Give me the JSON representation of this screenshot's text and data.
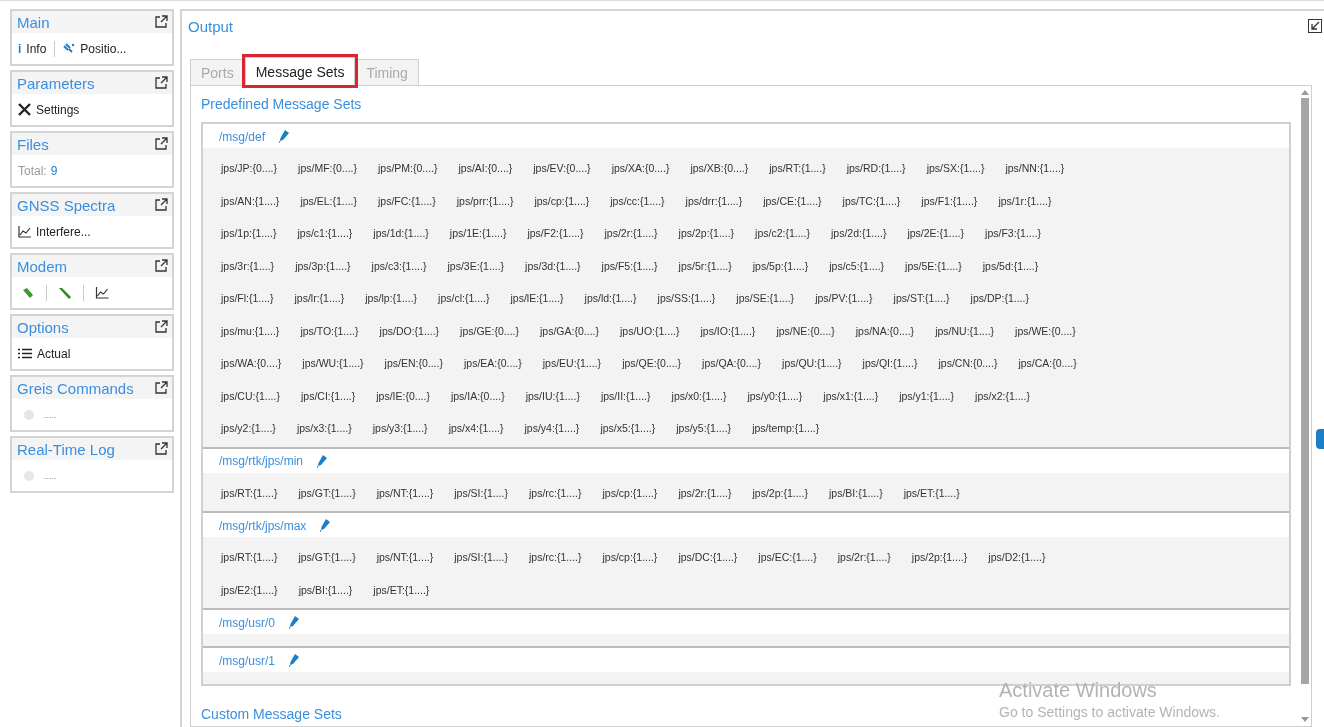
{
  "sidebar": [
    {
      "title": "Main",
      "kind": "main",
      "items": [
        {
          "kind": "info",
          "glyph": "i",
          "label": "Info"
        },
        {
          "kind": "position",
          "label": "Positio..."
        }
      ]
    },
    {
      "title": "Parameters",
      "kind": "single",
      "items": [
        {
          "kind": "tools",
          "label": "Settings"
        }
      ]
    },
    {
      "title": "Files",
      "kind": "total",
      "label": "Total:",
      "value": "9"
    },
    {
      "title": "GNSS Spectra",
      "kind": "single",
      "items": [
        {
          "kind": "chart",
          "label": "Interfere..."
        }
      ]
    },
    {
      "title": "Modem",
      "kind": "icons",
      "items": [
        {
          "kind": "link"
        },
        {
          "kind": "plug"
        },
        {
          "kind": "chart"
        }
      ]
    },
    {
      "title": "Options",
      "kind": "single",
      "items": [
        {
          "kind": "list",
          "label": "Actual"
        }
      ]
    },
    {
      "title": "Greis Commands",
      "kind": "status",
      "label": "....."
    },
    {
      "title": "Real-Time Log",
      "kind": "status",
      "label": "....."
    }
  ],
  "output": {
    "title": "Output",
    "tabs": [
      {
        "label": "Ports",
        "selected": false,
        "highlighted": false
      },
      {
        "label": "Message Sets",
        "selected": true,
        "highlighted": true
      },
      {
        "label": "Timing",
        "selected": false,
        "highlighted": false
      }
    ],
    "section_title": "Predefined Message Sets",
    "message_sets": [
      {
        "name": "/msg/def",
        "rows": [
          [
            "jps/JP:{0....}",
            "jps/MF:{0....}",
            "jps/PM:{0....}",
            "jps/AI:{0....}",
            "jps/EV:{0....}",
            "jps/XA:{0....}",
            "jps/XB:{0....}",
            "jps/RT:{1....}",
            "jps/RD:{1....}",
            "jps/SX:{1....}",
            "jps/NN:{1....}"
          ],
          [
            "jps/AN:{1....}",
            "jps/EL:{1....}",
            "jps/FC:{1....}",
            "jps/prr:{1....}",
            "jps/cp:{1....}",
            "jps/cc:{1....}",
            "jps/drr:{1....}",
            "jps/CE:{1....}",
            "jps/TC:{1....}",
            "jps/F1:{1....}",
            "jps/1r:{1....}"
          ],
          [
            "jps/1p:{1....}",
            "jps/c1:{1....}",
            "jps/1d:{1....}",
            "jps/1E:{1....}",
            "jps/F2:{1....}",
            "jps/2r:{1....}",
            "jps/2p:{1....}",
            "jps/c2:{1....}",
            "jps/2d:{1....}",
            "jps/2E:{1....}",
            "jps/F3:{1....}"
          ],
          [
            "jps/3r:{1....}",
            "jps/3p:{1....}",
            "jps/c3:{1....}",
            "jps/3E:{1....}",
            "jps/3d:{1....}",
            "jps/F5:{1....}",
            "jps/5r:{1....}",
            "jps/5p:{1....}",
            "jps/c5:{1....}",
            "jps/5E:{1....}",
            "jps/5d:{1....}"
          ],
          [
            "jps/Fl:{1....}",
            "jps/lr:{1....}",
            "jps/lp:{1....}",
            "jps/cl:{1....}",
            "jps/lE:{1....}",
            "jps/ld:{1....}",
            "jps/SS:{1....}",
            "jps/SE:{1....}",
            "jps/PV:{1....}",
            "jps/ST:{1....}",
            "jps/DP:{1....}"
          ],
          [
            "jps/mu:{1....}",
            "jps/TO:{1....}",
            "jps/DO:{1....}",
            "jps/GE:{0....}",
            "jps/GA:{0....}",
            "jps/UO:{1....}",
            "jps/IO:{1....}",
            "jps/NE:{0....}",
            "jps/NA:{0....}",
            "jps/NU:{1....}",
            "jps/WE:{0....}"
          ],
          [
            "jps/WA:{0....}",
            "jps/WU:{1....}",
            "jps/EN:{0....}",
            "jps/EA:{0....}",
            "jps/EU:{1....}",
            "jps/QE:{0....}",
            "jps/QA:{0....}",
            "jps/QU:{1....}",
            "jps/QI:{1....}",
            "jps/CN:{0....}",
            "jps/CA:{0....}"
          ],
          [
            "jps/CU:{1....}",
            "jps/CI:{1....}",
            "jps/IE:{0....}",
            "jps/IA:{0....}",
            "jps/IU:{1....}",
            "jps/II:{1....}",
            "jps/x0:{1....}",
            "jps/y0:{1....}",
            "jps/x1:{1....}",
            "jps/y1:{1....}",
            "jps/x2:{1....}"
          ],
          [
            "jps/y2:{1....}",
            "jps/x3:{1....}",
            "jps/y3:{1....}",
            "jps/x4:{1....}",
            "jps/y4:{1....}",
            "jps/x5:{1....}",
            "jps/y5:{1....}",
            "jps/temp:{1....}"
          ]
        ]
      },
      {
        "name": "/msg/rtk/jps/min",
        "rows": [
          [
            "jps/RT:{1....}",
            "jps/GT:{1....}",
            "jps/NT:{1....}",
            "jps/SI:{1....}",
            "jps/rc:{1....}",
            "jps/cp:{1....}",
            "jps/2r:{1....}",
            "jps/2p:{1....}",
            "jps/BI:{1....}",
            "jps/ET:{1....}"
          ]
        ]
      },
      {
        "name": "/msg/rtk/jps/max",
        "rows": [
          [
            "jps/RT:{1....}",
            "jps/GT:{1....}",
            "jps/NT:{1....}",
            "jps/SI:{1....}",
            "jps/rc:{1....}",
            "jps/cp:{1....}",
            "jps/DC:{1....}",
            "jps/EC:{1....}",
            "jps/2r:{1....}",
            "jps/2p:{1....}",
            "jps/D2:{1....}"
          ],
          [
            "jps/E2:{1....}",
            "jps/BI:{1....}",
            "jps/ET:{1....}"
          ]
        ]
      },
      {
        "name": "/msg/usr/0"
      },
      {
        "name": "/msg/usr/1"
      }
    ],
    "custom_title": "Custom Message Sets"
  },
  "os_notice": {
    "title": "Activate Windows",
    "subtitle": "Go to Settings to activate Windows."
  }
}
